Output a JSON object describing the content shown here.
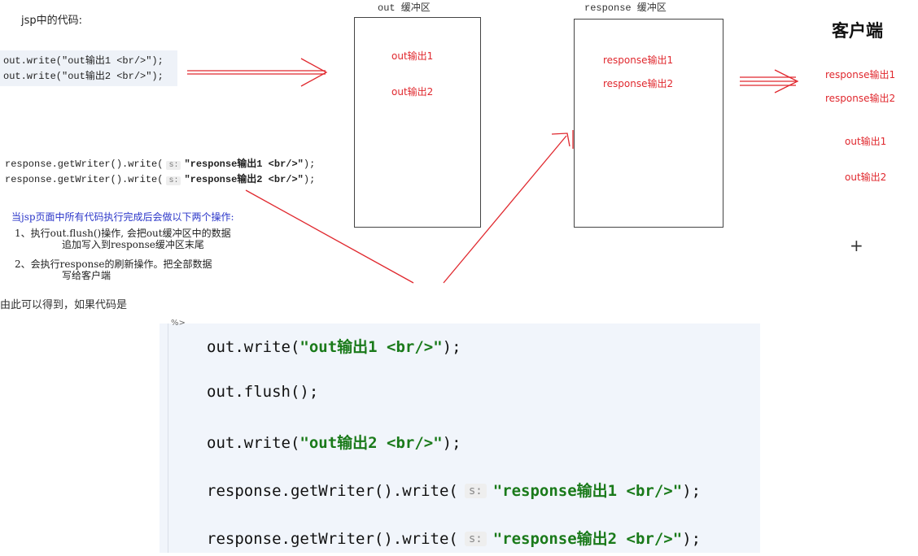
{
  "diagram": {
    "jsp_label": "jsp中的代码:",
    "out_code": [
      "out.write(\"out输出1 <br/>\");",
      "out.write(\"out输出2 <br/>\");"
    ],
    "response_code": [
      {
        "prefix": "response.getWriter().write(",
        "hint": "s:",
        "string": "\"response输出1 <br/>\"",
        "suffix": ");"
      },
      {
        "prefix": "response.getWriter().write(",
        "hint": "s:",
        "string": "\"response输出2 <br/>\"",
        "suffix": ");"
      }
    ],
    "out_buffer": {
      "title": "out 缓冲区",
      "items": [
        "out输出1",
        "out输出2"
      ]
    },
    "response_buffer": {
      "title": "response 缓冲区",
      "items": [
        "response输出1",
        "response输出2"
      ]
    },
    "client": {
      "title": "客户端",
      "items": [
        "response输出1",
        "response输出2",
        "out输出1",
        "out输出2"
      ]
    },
    "note": {
      "heading": "当jsp页面中所有代码执行完成后会做以下两个操作:",
      "step1_line1": "1、执行out.flush()操作, 会把out缓冲区中的数据",
      "step1_line2": "追加写入到response缓冲区末尾",
      "step2_line1": "2、会执行response的刷新操作。把全部数据",
      "step2_line2": "写给客户端"
    },
    "colors": {
      "arrow": "#e0282e",
      "note": "#2b36c9",
      "code_string": "#1a7a1a"
    }
  },
  "caption": "由此可以得到，如果代码是",
  "code_block": {
    "lines": [
      {
        "prefix": "out.write(",
        "hint": "",
        "string": "\"out输出1 <br/>\"",
        "suffix": ");"
      },
      {
        "prefix": "out.flush();",
        "hint": "",
        "string": "",
        "suffix": ""
      },
      {
        "prefix": "out.write(",
        "hint": "",
        "string": "\"out输出2 <br/>\"",
        "suffix": ");"
      },
      {
        "prefix": "response.getWriter().write(",
        "hint": "s:",
        "string": "\"response输出1 <br/>\"",
        "suffix": ");"
      },
      {
        "prefix": "response.getWriter().write(",
        "hint": "s:",
        "string": "\"response输出2 <br/>\"",
        "suffix": ");"
      }
    ]
  }
}
